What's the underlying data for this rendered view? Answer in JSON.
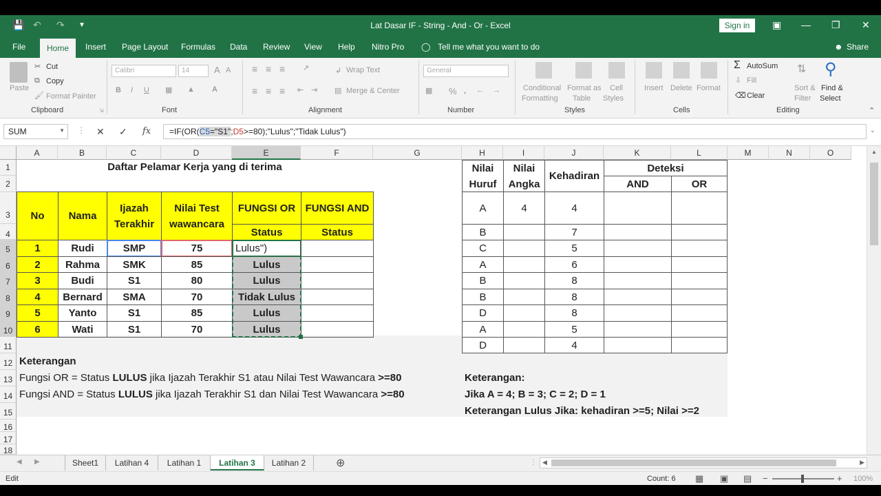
{
  "window": {
    "title": "Lat Dasar IF - String - And - Or  -  Excel",
    "signin": "Sign in"
  },
  "tabs": [
    "File",
    "Home",
    "Insert",
    "Page Layout",
    "Formulas",
    "Data",
    "Review",
    "View",
    "Help",
    "Nitro Pro"
  ],
  "tellme": "Tell me what you want to do",
  "share": "Share",
  "ribbon": {
    "clipboard": {
      "label": "Clipboard",
      "paste": "Paste",
      "cut": "Cut",
      "copy": "Copy",
      "format_painter": "Format Painter"
    },
    "font": {
      "label": "Font",
      "name": "Calibri",
      "size": "14"
    },
    "alignment": {
      "label": "Alignment",
      "wrap": "Wrap Text",
      "merge": "Merge & Center"
    },
    "number": {
      "label": "Number",
      "format": "General"
    },
    "styles": {
      "label": "Styles",
      "cond1": "Conditional",
      "cond2": "Formatting",
      "fmt1": "Format as",
      "fmt2": "Table",
      "cell1": "Cell",
      "cell2": "Styles"
    },
    "cells": {
      "label": "Cells",
      "insert": "Insert",
      "delete": "Delete",
      "format": "Format"
    },
    "editing": {
      "label": "Editing",
      "autosum": "AutoSum",
      "fill": "Fill",
      "clear": "Clear",
      "sort1": "Sort &",
      "sort2": "Filter",
      "find1": "Find &",
      "find2": "Select"
    }
  },
  "formula_bar": {
    "name_box": "SUM",
    "f_pre": "=IF(OR(",
    "f_ref": "C5",
    "f_str": "=\"S1\"",
    "f_sep": ";",
    "f_d5": "D5",
    "f_post": ">=80);\"Lulus\";\"Tidak Lulus\")"
  },
  "columns": [
    "A",
    "B",
    "C",
    "D",
    "E",
    "F",
    "G",
    "H",
    "I",
    "J",
    "K",
    "L",
    "M",
    "N",
    "O"
  ],
  "rows": [
    "1",
    "2",
    "3",
    "4",
    "5",
    "6",
    "7",
    "8",
    "9",
    "10",
    "11",
    "12",
    "13",
    "14",
    "15",
    "16",
    "17",
    "18"
  ],
  "table1": {
    "title": "Daftar Pelamar Kerja yang di terima",
    "h_no": "No",
    "h_nama": "Nama",
    "h_ijazah": "Ijazah Terakhir",
    "h_nilai": "Nilai Test wawancara",
    "h_or": "FUNGSI OR",
    "h_and": "FUNGSI AND",
    "h_status1": "Status",
    "h_status2": "Status",
    "rows": [
      {
        "no": "1",
        "nama": "Rudi",
        "ijazah": "SMP",
        "nilai": "75",
        "or": "Lulus\")",
        "and": ""
      },
      {
        "no": "2",
        "nama": "Rahma",
        "ijazah": "SMK",
        "nilai": "85",
        "or": "Lulus",
        "and": ""
      },
      {
        "no": "3",
        "nama": "Budi",
        "ijazah": "S1",
        "nilai": "80",
        "or": "Lulus",
        "and": ""
      },
      {
        "no": "4",
        "nama": "Bernard",
        "ijazah": "SMA",
        "nilai": "70",
        "or": "Tidak Lulus",
        "and": ""
      },
      {
        "no": "5",
        "nama": "Yanto",
        "ijazah": "S1",
        "nilai": "85",
        "or": "Lulus",
        "and": ""
      },
      {
        "no": "6",
        "nama": "Wati",
        "ijazah": "S1",
        "nilai": "70",
        "or": "Lulus",
        "and": ""
      }
    ]
  },
  "table2": {
    "h_huruf": "Nilai Huruf",
    "h_angka": "Nilai Angka",
    "h_kehadiran": "Kehadiran",
    "h_deteksi": "Deteksi",
    "h_and": "AND",
    "h_or": "OR",
    "rows": [
      {
        "huruf": "A",
        "angka": "4",
        "kehadiran": "4"
      },
      {
        "huruf": "B",
        "angka": "",
        "kehadiran": "7"
      },
      {
        "huruf": "C",
        "angka": "",
        "kehadiran": "5"
      },
      {
        "huruf": "A",
        "angka": "",
        "kehadiran": "6"
      },
      {
        "huruf": "B",
        "angka": "",
        "kehadiran": "8"
      },
      {
        "huruf": "B",
        "angka": "",
        "kehadiran": "8"
      },
      {
        "huruf": "D",
        "angka": "",
        "kehadiran": "8"
      },
      {
        "huruf": "A",
        "angka": "",
        "kehadiran": "5"
      },
      {
        "huruf": "D",
        "angka": "",
        "kehadiran": "4"
      }
    ]
  },
  "notes": {
    "keterangan": "Keterangan",
    "or_a": "Fungsi OR = Status ",
    "or_b": "LULUS",
    "or_c": " jika Ijazah Terakhir S1 atau Nilai Test Wawancara ",
    "or_d": ">=80",
    "and_a": "Fungsi AND = Status ",
    "and_b": "LULUS",
    "and_c": " jika Ijazah Terakhir S1 dan Nilai Test Wawancara ",
    "and_d": ">=80",
    "k2": "Keterangan:",
    "k2_line1": "Jika A = 4; B = 3; C = 2; D = 1",
    "k2_line2": "Keterangan Lulus Jika: kehadiran >=5; Nilai >=2"
  },
  "sheets": [
    "Sheet1",
    "Latihan 4",
    "Latihan 1",
    "Latihan 3",
    "Latihan 2"
  ],
  "active_sheet": "Latihan 3",
  "status": {
    "mode": "Edit",
    "count": "Count: 6",
    "zoom": "100%"
  }
}
